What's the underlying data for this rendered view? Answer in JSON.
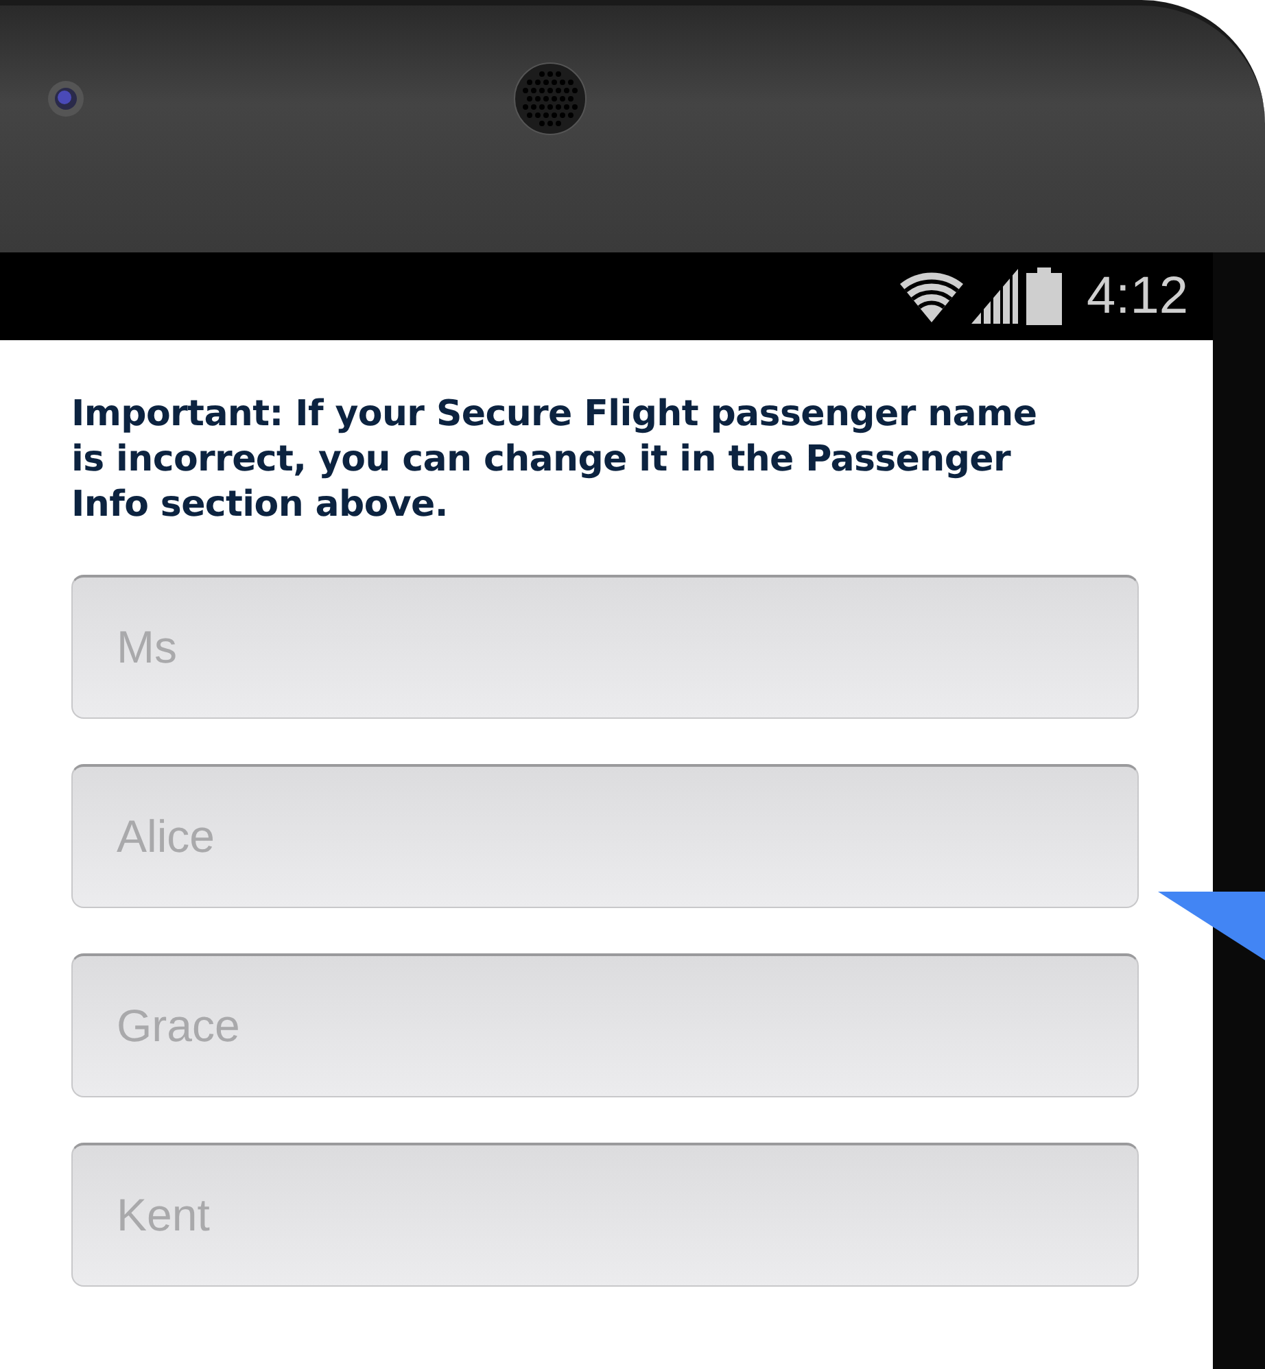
{
  "status_bar": {
    "time": "4:12"
  },
  "notice": "Important: If your Secure Flight passenger name is incorrect, you can change it in the Passenger Info section above.",
  "fields": [
    {
      "value": "Ms",
      "disabled": true
    },
    {
      "value": "Alice",
      "disabled": true
    },
    {
      "value": "Grace",
      "disabled": true
    },
    {
      "value": "Kent",
      "disabled": true
    }
  ]
}
